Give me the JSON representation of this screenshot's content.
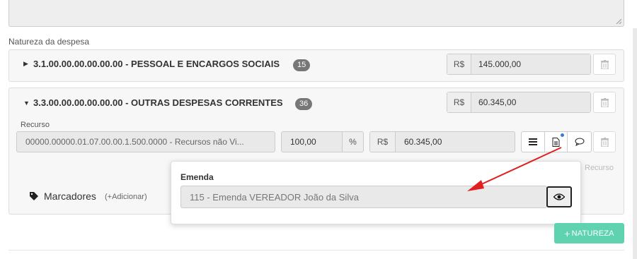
{
  "section_label": "Natureza da despesa",
  "naturezas": [
    {
      "code_title": "3.1.00.00.00.00.00.00 - PESSOAL E ENCARGOS SOCIAIS",
      "count": "15",
      "currency": "R$",
      "value": "145.000,00",
      "expanded": false
    },
    {
      "code_title": "3.3.00.00.00.00.00.00 - OUTRAS DESPESAS CORRENTES",
      "count": "36",
      "currency": "R$",
      "value": "60.345,00",
      "expanded": true
    }
  ],
  "recurso": {
    "label": "Recurso",
    "value": "00000.00000.01.07.00.00.1.500.0000 - Recursos não Vi...",
    "percent": "100,00",
    "percent_symbol": "%",
    "currency": "R$",
    "amount": "60.345,00",
    "hint": "Recurso"
  },
  "marcadores": {
    "label": "Marcadores",
    "add_link": "(+Adicionar)"
  },
  "popover": {
    "label": "Emenda",
    "value": "115 - Emenda VEREADOR João da Silva"
  },
  "add_button": {
    "icon": "+",
    "label": "NATUREZA"
  },
  "colors": {
    "accent_green": "#5fd3b0",
    "badge_gray": "#777777",
    "arrow_red": "#e02020",
    "dot_blue": "#3a7bd5"
  },
  "icons": [
    "trash-icon",
    "menu-icon",
    "document-icon",
    "comment-icon",
    "eye-icon",
    "tag-icon",
    "caret-right-icon",
    "caret-down-icon"
  ]
}
